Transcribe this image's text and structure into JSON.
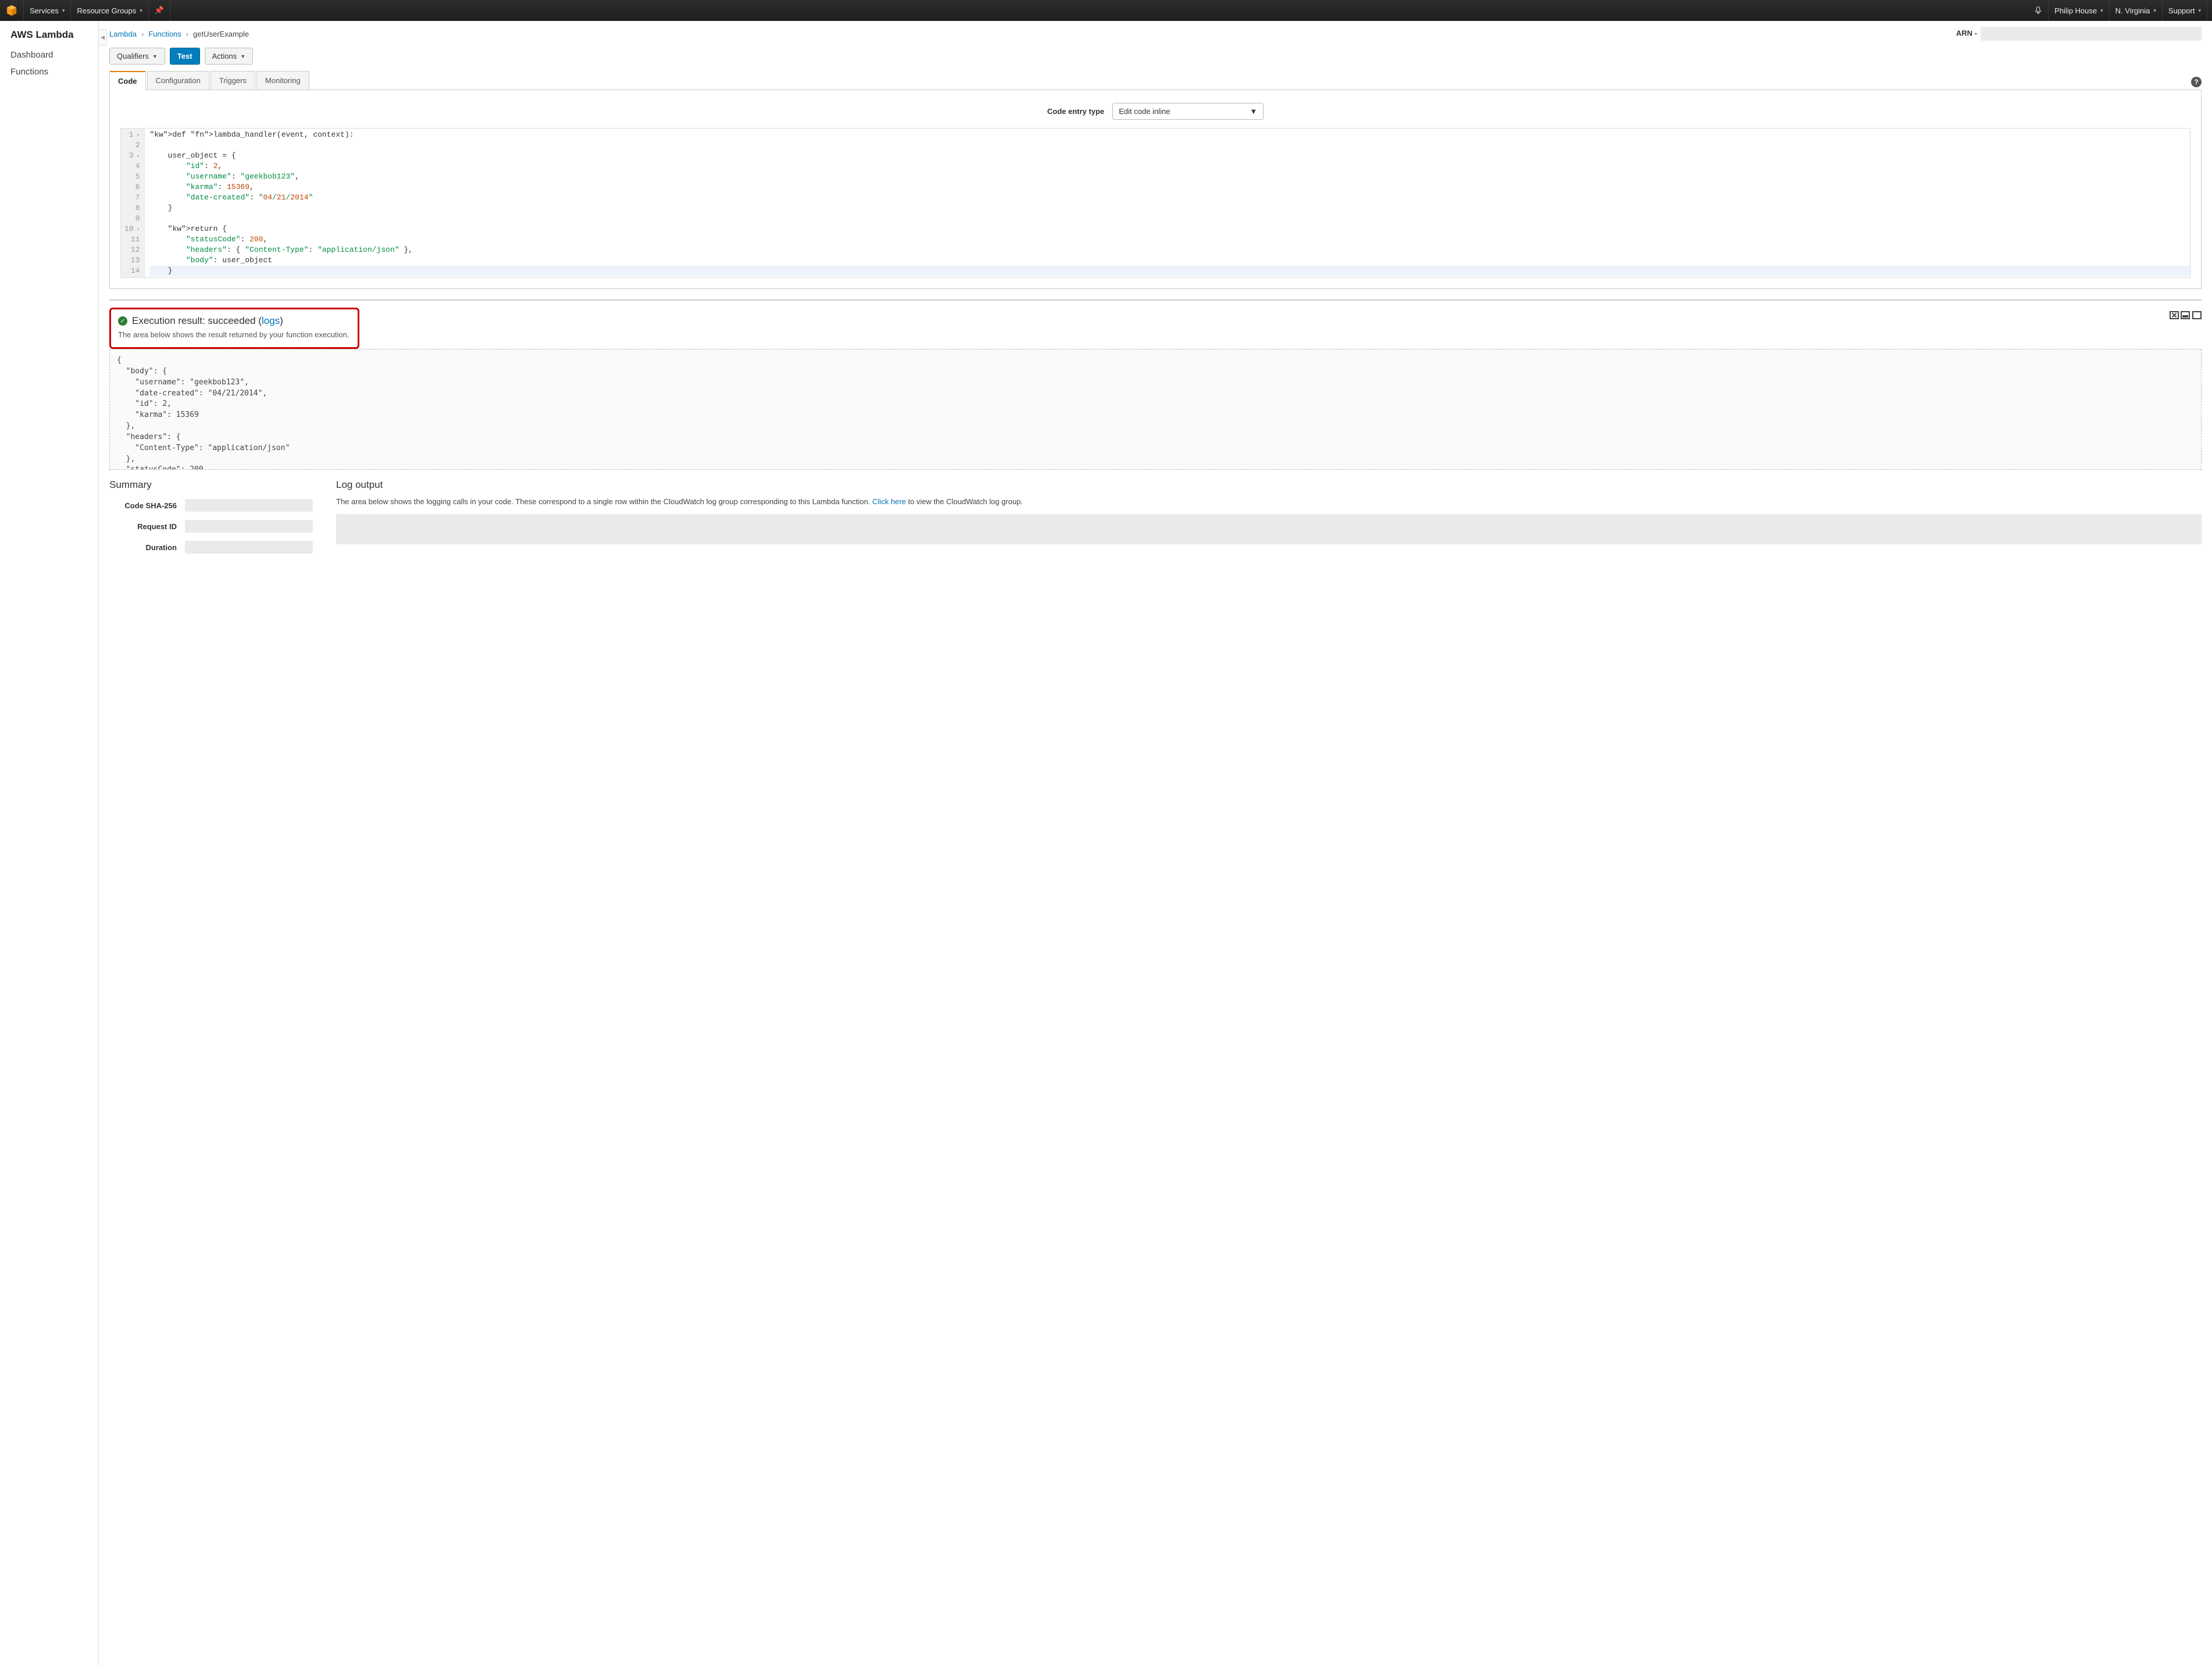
{
  "topnav": {
    "services": "Services",
    "resource_groups": "Resource Groups",
    "user": "Philip House",
    "region": "N. Virginia",
    "support": "Support"
  },
  "sidebar": {
    "title": "AWS Lambda",
    "items": [
      "Dashboard",
      "Functions"
    ]
  },
  "breadcrumb": {
    "root": "Lambda",
    "section": "Functions",
    "current": "getUserExample",
    "arn_label": "ARN -"
  },
  "buttons": {
    "qualifiers": "Qualifiers",
    "test": "Test",
    "actions": "Actions"
  },
  "tabs": [
    "Code",
    "Configuration",
    "Triggers",
    "Monitoring"
  ],
  "code_entry": {
    "label": "Code entry type",
    "value": "Edit code inline"
  },
  "code_lines": [
    "def lambda_handler(event, context):",
    "",
    "    user_object = {",
    "        \"id\": 2,",
    "        \"username\": \"geekbob123\",",
    "        \"karma\": 15369,",
    "        \"date-created\": \"04/21/2014\"",
    "    }",
    "",
    "    return {",
    "        \"statusCode\": 200,",
    "        \"headers\": { \"Content-Type\": \"application/json\" },",
    "        \"body\": user_object",
    "    }"
  ],
  "result": {
    "heading_prefix": "Execution result: succeeded (",
    "heading_link": "logs",
    "heading_suffix": ")",
    "sub": "The area below shows the result returned by your function execution.",
    "output": "{\n  \"body\": {\n    \"username\": \"geekbob123\",\n    \"date-created\": \"04/21/2014\",\n    \"id\": 2,\n    \"karma\": 15369\n  },\n  \"headers\": {\n    \"Content-Type\": \"application/json\"\n  },\n  \"statusCode\": 200"
  },
  "summary": {
    "title": "Summary",
    "rows": [
      "Code SHA-256",
      "Request ID",
      "Duration"
    ]
  },
  "log": {
    "title": "Log output",
    "desc_prefix": "The area below shows the logging calls in your code. These correspond to a single row within the CloudWatch log group corresponding to this Lambda function. ",
    "desc_link": "Click here",
    "desc_suffix": " to view the CloudWatch log group."
  }
}
